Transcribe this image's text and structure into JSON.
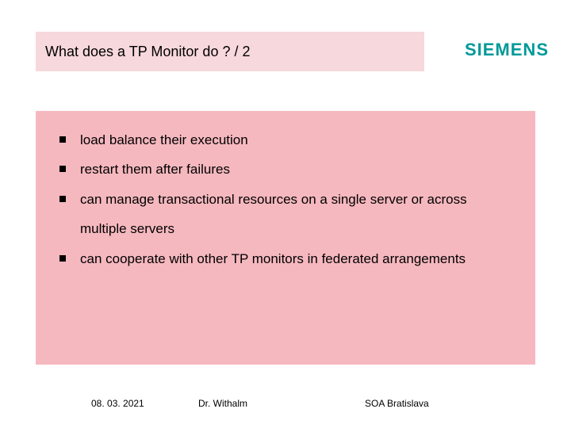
{
  "header": {
    "title": "What does a TP Monitor do ? / 2"
  },
  "logo": {
    "text": "SIEMENS"
  },
  "body": {
    "bullets": [
      "load balance their execution",
      "restart them after failures",
      "can manage transactional resources on a single server or across multiple servers",
      "can cooperate with other TP monitors in federated arrangements"
    ]
  },
  "footer": {
    "date": "08. 03. 2021",
    "author": "Dr. Withalm",
    "event": "SOA Bratislava"
  }
}
